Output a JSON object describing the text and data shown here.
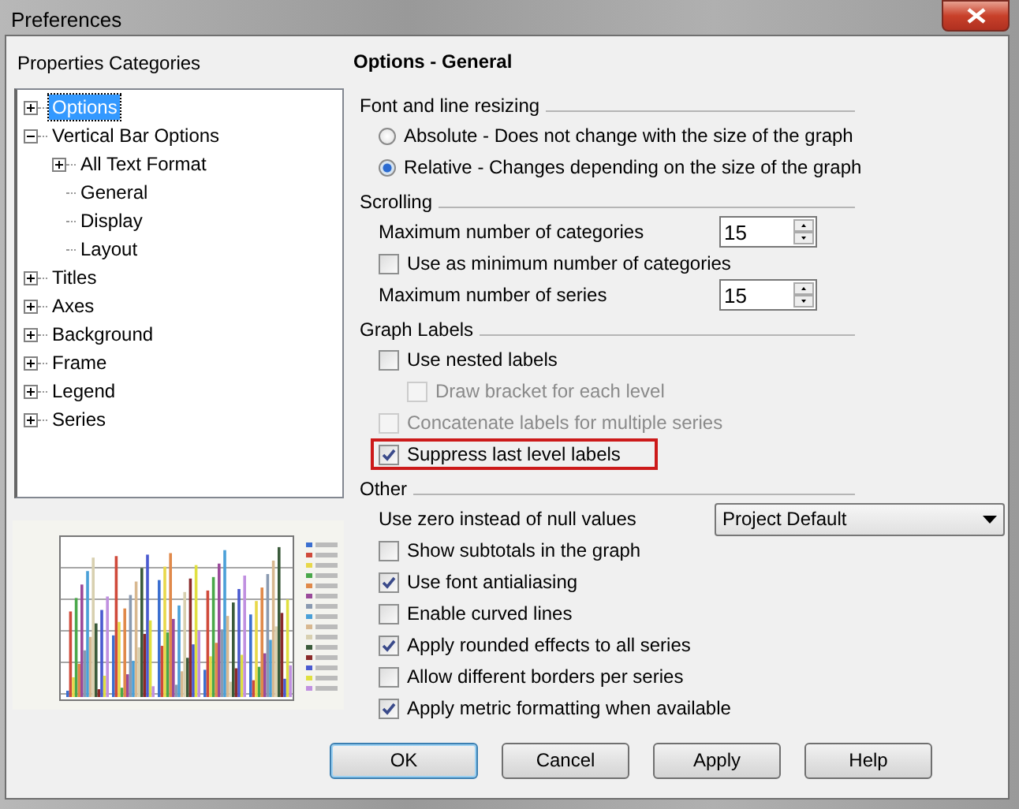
{
  "window": {
    "title": "Preferences"
  },
  "categories": {
    "title": "Properties Categories",
    "tree": [
      {
        "label": "Options",
        "kind": "folder",
        "expanded": false,
        "selected": true
      },
      {
        "label": "Vertical Bar Options",
        "kind": "folder",
        "expanded": true,
        "selected": false,
        "children": [
          {
            "label": "All Text Format",
            "kind": "folder",
            "expanded": false,
            "selected": false
          },
          {
            "label": "General",
            "kind": "leaf",
            "selected": false
          },
          {
            "label": "Display",
            "kind": "leaf",
            "selected": false
          },
          {
            "label": "Layout",
            "kind": "leaf",
            "selected": false
          }
        ]
      },
      {
        "label": "Titles",
        "kind": "folder",
        "expanded": false,
        "selected": false
      },
      {
        "label": "Axes",
        "kind": "folder",
        "expanded": false,
        "selected": false
      },
      {
        "label": "Background",
        "kind": "folder",
        "expanded": false,
        "selected": false
      },
      {
        "label": "Frame",
        "kind": "folder",
        "expanded": false,
        "selected": false
      },
      {
        "label": "Legend",
        "kind": "folder",
        "expanded": false,
        "selected": false
      },
      {
        "label": "Series",
        "kind": "folder",
        "expanded": false,
        "selected": false
      }
    ]
  },
  "panel": {
    "title": "Options - General",
    "groups": [
      {
        "title": "Font and line resizing",
        "items": [
          {
            "kind": "radio",
            "label": "Absolute - Does not change with the size of the graph",
            "selected": false
          },
          {
            "kind": "radio",
            "label": "Relative - Changes depending on the size of the graph",
            "selected": true
          }
        ]
      },
      {
        "title": "Scrolling",
        "items": [
          {
            "kind": "spinner",
            "label": "Maximum number of categories",
            "value": "15"
          },
          {
            "kind": "checkbox",
            "label": "Use as minimum number of categories",
            "checked": false,
            "disabled": false,
            "highlighted": false
          },
          {
            "kind": "spinner",
            "label": "Maximum number of series",
            "value": "15"
          }
        ]
      },
      {
        "title": "Graph Labels",
        "items": [
          {
            "kind": "checkbox",
            "label": "Use nested labels",
            "checked": false,
            "disabled": false,
            "highlighted": false,
            "children": [
              {
                "kind": "checkbox",
                "label": "Draw bracket for each level",
                "checked": false,
                "disabled": true,
                "highlighted": false
              }
            ]
          },
          {
            "kind": "checkbox",
            "label": "Concatenate labels for multiple series",
            "checked": false,
            "disabled": true,
            "highlighted": false
          },
          {
            "kind": "checkbox",
            "label": "Suppress last level labels",
            "checked": true,
            "disabled": false,
            "highlighted": true
          }
        ]
      },
      {
        "title": "Other",
        "items": [
          {
            "kind": "dropdown",
            "label": "Use zero instead of null values",
            "value": "Project Default"
          },
          {
            "kind": "checkbox",
            "label": "Show subtotals in the graph",
            "checked": false,
            "disabled": false,
            "highlighted": false
          },
          {
            "kind": "checkbox",
            "label": "Use font antialiasing",
            "checked": true,
            "disabled": false,
            "highlighted": false
          },
          {
            "kind": "checkbox",
            "label": "Enable curved lines",
            "checked": false,
            "disabled": false,
            "highlighted": false
          },
          {
            "kind": "checkbox",
            "label": "Apply rounded effects to all series",
            "checked": true,
            "disabled": false,
            "highlighted": false
          },
          {
            "kind": "checkbox",
            "label": "Allow different borders per series",
            "checked": false,
            "disabled": false,
            "highlighted": false
          },
          {
            "kind": "checkbox",
            "label": "Apply metric formatting when available",
            "checked": true,
            "disabled": false,
            "highlighted": false
          }
        ]
      }
    ]
  },
  "buttons": [
    {
      "label": "OK",
      "default": true
    },
    {
      "label": "Cancel",
      "default": false
    },
    {
      "label": "Apply",
      "default": false
    },
    {
      "label": "Help",
      "default": false
    }
  ]
}
